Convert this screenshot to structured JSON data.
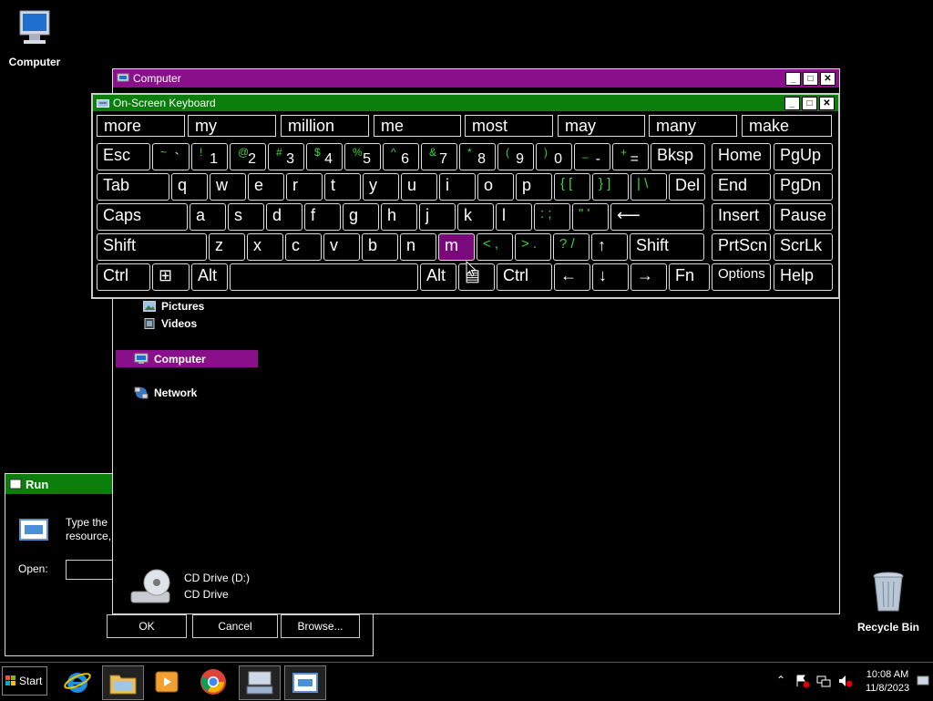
{
  "desktop": {
    "computer_icon_label": "Computer",
    "recycle_label": "Recycle Bin"
  },
  "explorer": {
    "title": "Computer",
    "nav": {
      "pictures": "Pictures",
      "videos": "Videos",
      "computer": "Computer",
      "network": "Network"
    },
    "drive_name": "CD Drive (D:)",
    "drive_type": "CD Drive"
  },
  "osk": {
    "title": "On-Screen Keyboard",
    "predictions": [
      "more",
      "my",
      "million",
      "me",
      "most",
      "may",
      "many",
      "make"
    ],
    "row1": [
      {
        "k": "Esc"
      },
      {
        "s": "~",
        "b": "`"
      },
      {
        "s": "!",
        "b": "1"
      },
      {
        "s": "@",
        "b": "2"
      },
      {
        "s": "#",
        "b": "3"
      },
      {
        "s": "$",
        "b": "4"
      },
      {
        "s": "%",
        "b": "5"
      },
      {
        "s": "^",
        "b": "6"
      },
      {
        "s": "&",
        "b": "7"
      },
      {
        "s": "*",
        "b": "8"
      },
      {
        "s": "(",
        "b": "9"
      },
      {
        "s": ")",
        "b": "0"
      },
      {
        "s": "_",
        "b": "-"
      },
      {
        "s": "+",
        "b": "="
      },
      {
        "k": "Bksp"
      },
      {
        "k": "Home"
      },
      {
        "k": "PgUp"
      }
    ],
    "row2": [
      "Tab",
      "q",
      "w",
      "e",
      "r",
      "t",
      "y",
      "u",
      "i",
      "o",
      "p",
      "{ [",
      "} ]",
      "| \\",
      "Del",
      "End",
      "PgDn"
    ],
    "row3": [
      "Caps",
      "a",
      "s",
      "d",
      "f",
      "g",
      "h",
      "j",
      "k",
      "l",
      ": ;",
      "\" '",
      "⟵",
      "Insert",
      "Pause"
    ],
    "row4": [
      "Shift",
      "z",
      "x",
      "c",
      "v",
      "b",
      "n",
      "m",
      "< ,",
      "> .",
      "? /",
      "↑",
      "Shift",
      "PrtScn",
      "ScrLk"
    ],
    "row5": [
      "Ctrl",
      "⊞",
      "Alt",
      "",
      "Alt",
      "▤",
      "Ctrl",
      "←",
      "↓",
      "→",
      "Fn",
      "Options",
      "Help"
    ]
  },
  "run": {
    "title": "Run",
    "desc_line1": "Type the",
    "desc_line2": "resource,",
    "open_label": "Open:",
    "ok": "OK",
    "cancel": "Cancel",
    "browse": "Browse..."
  },
  "taskbar": {
    "start": "Start",
    "time": "10:08 AM",
    "date": "11/8/2023"
  }
}
